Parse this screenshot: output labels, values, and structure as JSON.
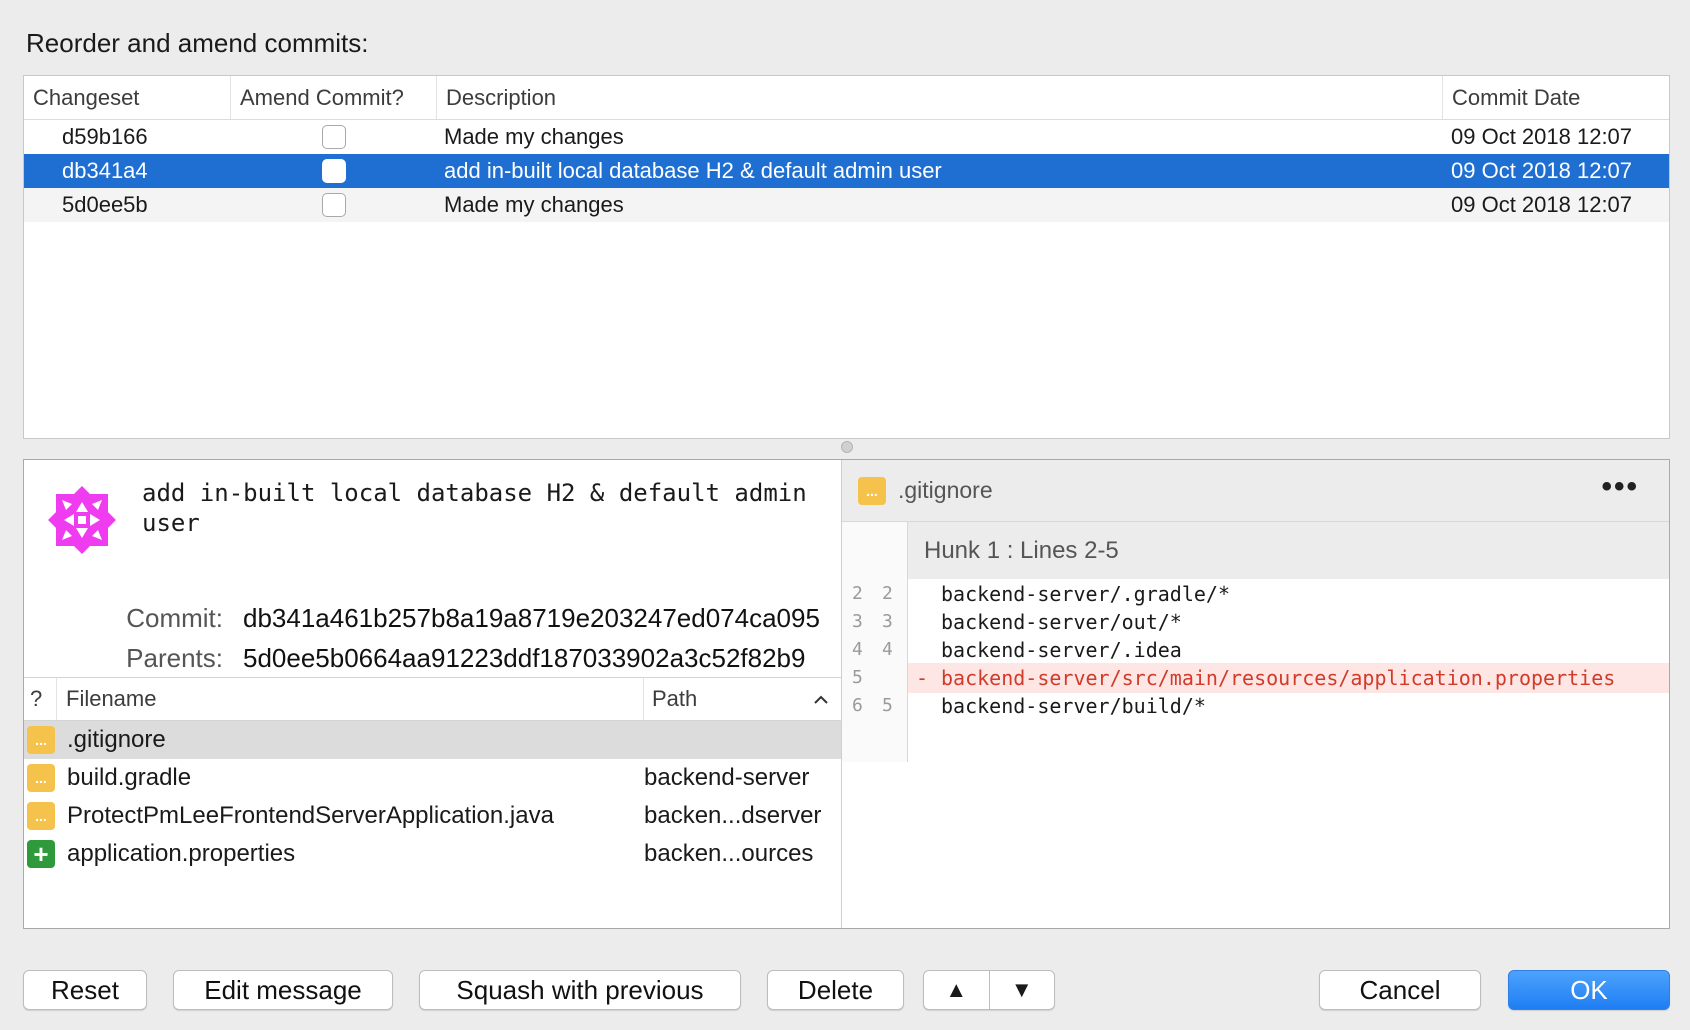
{
  "dialog": {
    "heading": "Reorder and amend commits:"
  },
  "commits_table": {
    "headers": [
      "Changeset",
      "Amend Commit?",
      "Description",
      "Commit Date"
    ],
    "rows": [
      {
        "changeset": "d59b166",
        "description": "Made my changes",
        "date": "09 Oct 2018 12:07"
      },
      {
        "changeset": "db341a4",
        "description": "add in-built local database H2 & default admin user",
        "date": "09 Oct 2018 12:07"
      },
      {
        "changeset": "5d0ee5b",
        "description": "Made my changes",
        "date": "09 Oct 2018 12:07"
      }
    ]
  },
  "details": {
    "message": "add in-built local database H2 & default admin user",
    "commit_label": "Commit:",
    "commit_hash": "db341a461b257b8a19a8719e203247ed074ca095",
    "parents_label": "Parents:",
    "parents_hash": "5d0ee5b0664aa91223ddf187033902a3c52f82b9",
    "avatar_color": "#f03cf0"
  },
  "files": {
    "headers": {
      "status": "?",
      "filename": "Filename",
      "path": "Path",
      "sort_icon": "chevron-up-icon"
    },
    "rows": [
      {
        "name": ".gitignore",
        "path": "",
        "status": "modified",
        "icon": "..."
      },
      {
        "name": "build.gradle",
        "path": "backend-server",
        "status": "modified",
        "icon": "..."
      },
      {
        "name": "ProtectPmLeeFrontendServerApplication.java",
        "path": "backen...dserver",
        "status": "modified",
        "icon": "..."
      },
      {
        "name": "application.properties",
        "path": "backen...ources",
        "status": "added",
        "icon": "+"
      }
    ]
  },
  "diff": {
    "file": ".gitignore",
    "file_icon": "...",
    "more": "•••",
    "hunk": "Hunk 1 : Lines 2-5",
    "lines": [
      {
        "old": "2",
        "new": "2",
        "text": "backend-server/.gradle/*",
        "type": "context",
        "sign": ""
      },
      {
        "old": "3",
        "new": "3",
        "text": "backend-server/out/*",
        "type": "context",
        "sign": ""
      },
      {
        "old": "4",
        "new": "4",
        "text": "backend-server/.idea",
        "type": "context",
        "sign": ""
      },
      {
        "old": "5",
        "new": "",
        "text": "backend-server/src/main/resources/application.properties",
        "type": "removed",
        "sign": "-"
      },
      {
        "old": "6",
        "new": "5",
        "text": "backend-server/build/*",
        "type": "context",
        "sign": ""
      }
    ]
  },
  "buttons": {
    "reset": "Reset",
    "edit_message": "Edit message",
    "squash": "Squash with previous",
    "delete": "Delete",
    "move_up": "▲",
    "move_down": "▼",
    "cancel": "Cancel",
    "ok": "OK"
  },
  "colors": {
    "selection": "#1f6fd3",
    "primary_button": "#1f7ef3",
    "removed_text": "#d23a2a",
    "modified_icon": "#f5c24c",
    "added_icon": "#2f9a3b"
  }
}
